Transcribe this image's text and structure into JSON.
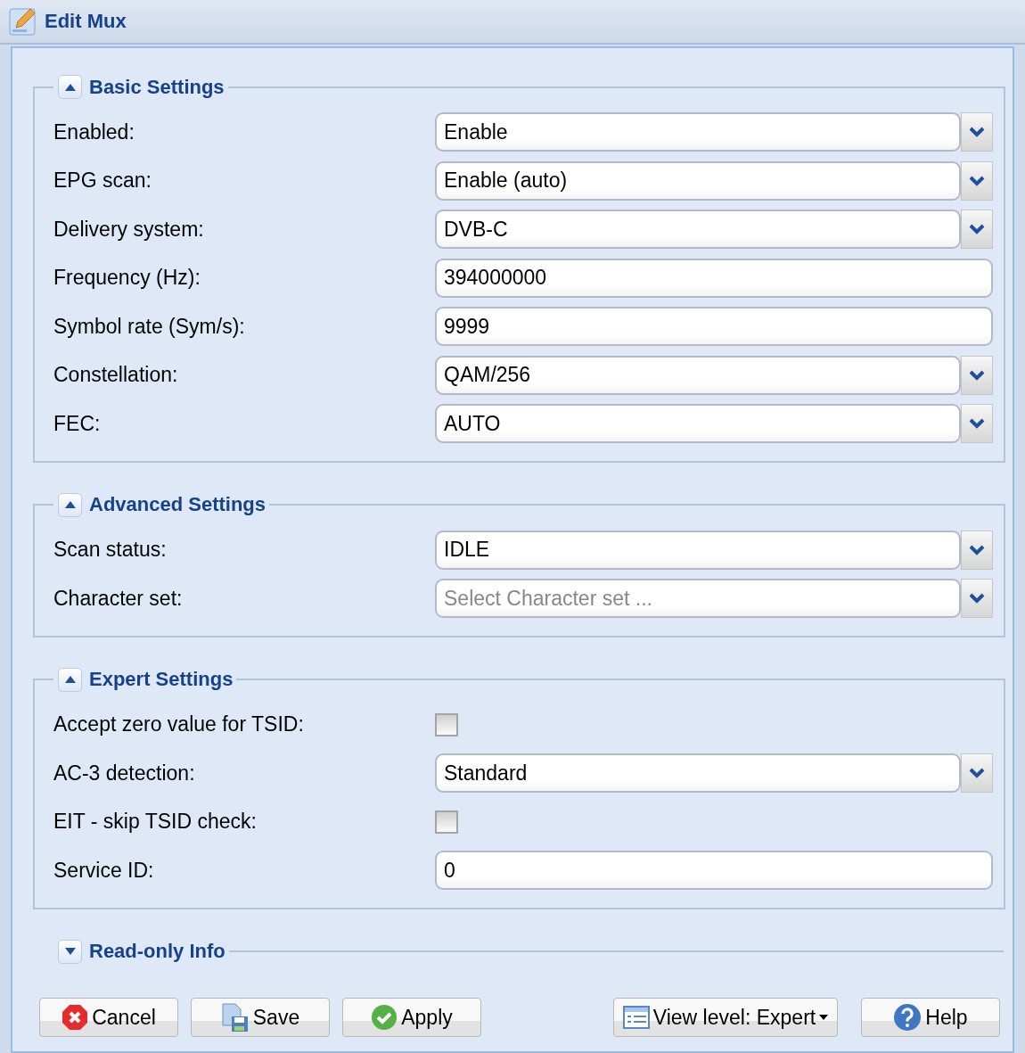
{
  "window": {
    "title": "Edit Mux"
  },
  "sections": [
    {
      "title": "Basic Settings",
      "expanded": true,
      "rows": [
        {
          "kind": "combo",
          "label": "Enabled:",
          "value": "Enable"
        },
        {
          "kind": "combo",
          "label": "EPG scan:",
          "value": "Enable (auto)"
        },
        {
          "kind": "combo",
          "label": "Delivery system:",
          "value": "DVB-C"
        },
        {
          "kind": "text",
          "label": "Frequency (Hz):",
          "value": "394000000"
        },
        {
          "kind": "text",
          "label": "Symbol rate (Sym/s):",
          "value": "9999"
        },
        {
          "kind": "combo",
          "label": "Constellation:",
          "value": "QAM/256"
        },
        {
          "kind": "combo",
          "label": "FEC:",
          "value": "AUTO"
        }
      ]
    },
    {
      "title": "Advanced Settings",
      "expanded": true,
      "rows": [
        {
          "kind": "combo",
          "label": "Scan status:",
          "value": "IDLE"
        },
        {
          "kind": "combo",
          "label": "Character set:",
          "placeholder": "Select Character set ..."
        }
      ]
    },
    {
      "title": "Expert Settings",
      "expanded": true,
      "rows": [
        {
          "kind": "checkbox",
          "label": "Accept zero value for TSID:",
          "checked": false
        },
        {
          "kind": "combo",
          "label": "AC-3 detection:",
          "value": "Standard"
        },
        {
          "kind": "checkbox",
          "label": "EIT - skip TSID check:",
          "checked": false
        },
        {
          "kind": "text",
          "label": "Service ID:",
          "value": "0"
        }
      ]
    },
    {
      "title": "Read-only Info",
      "expanded": false
    }
  ],
  "buttons": [
    {
      "kind": "cancel",
      "label": "Cancel"
    },
    {
      "kind": "save",
      "label": "Save"
    },
    {
      "kind": "apply",
      "label": "Apply"
    },
    {
      "kind": "viewlevel",
      "label": "View level: Expert"
    },
    {
      "kind": "help",
      "label": "Help"
    }
  ]
}
